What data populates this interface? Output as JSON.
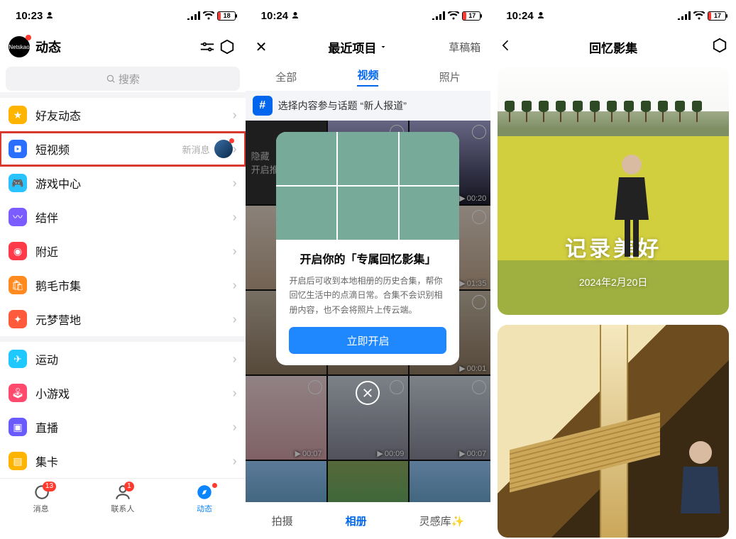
{
  "statusbars": {
    "phone1": {
      "time": "10:23",
      "battery_pct": "18"
    },
    "phone2": {
      "time": "10:24",
      "battery_pct": "17"
    },
    "phone3": {
      "time": "10:24",
      "battery_pct": "17"
    }
  },
  "phone1": {
    "avatar_text": "Netskao",
    "header_title": "动态",
    "search_placeholder": "搜索",
    "items_a": [
      {
        "label": "好友动态"
      },
      {
        "label": "短视频",
        "note": "新消息"
      },
      {
        "label": "游戏中心"
      },
      {
        "label": "结伴"
      },
      {
        "label": "附近"
      },
      {
        "label": "鹅毛市集"
      },
      {
        "label": "元梦营地"
      }
    ],
    "items_b": [
      {
        "label": "运动"
      },
      {
        "label": "小游戏"
      },
      {
        "label": "直播"
      },
      {
        "label": "集卡"
      }
    ],
    "tabbar": {
      "messages": {
        "label": "消息",
        "badge": "13"
      },
      "contacts": {
        "label": "联系人",
        "badge": "1"
      },
      "feeds": {
        "label": "动态"
      }
    }
  },
  "phone2": {
    "nav": {
      "center": "最近项目",
      "drafts": "草稿箱"
    },
    "tabs": [
      "全部",
      "视频",
      "照片"
    ],
    "topic": "选择内容参与话题 “新人报道”",
    "first_cell": {
      "line1": "隐藏",
      "line2": "开启推荐"
    },
    "grid_durations": [
      "00:20",
      "",
      "01:35",
      "",
      "",
      "00:01",
      "00:07",
      "00:09",
      "00:07"
    ],
    "modal": {
      "title": "开启你的「专属回忆影集」",
      "body": "开启后可收到本地相册的历史合集，帮你回忆生活中的点滴日常。合集不会识别相册内容，也不会将照片上传云端。",
      "button": "立即开启"
    },
    "bottom_tabs": [
      "拍摄",
      "相册",
      "灵感库✨"
    ]
  },
  "phone3": {
    "title": "回忆影集",
    "card1": {
      "big": "记录美好",
      "date": "2024年2月20日"
    }
  }
}
